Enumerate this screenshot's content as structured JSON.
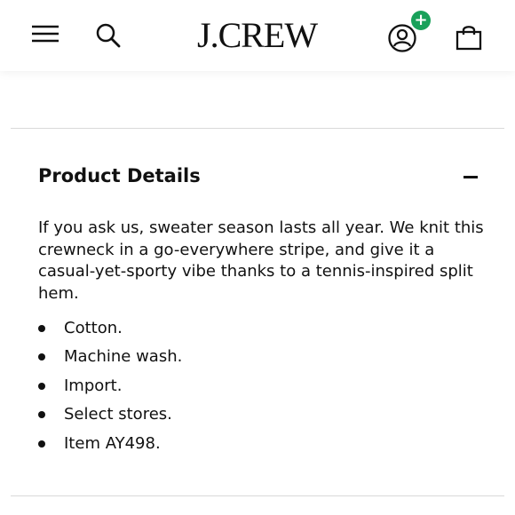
{
  "header": {
    "logo_text": "J.CREW",
    "icons": {
      "menu": "hamburger-menu-icon",
      "search": "search-icon",
      "account": "account-icon",
      "add_badge": "plus-icon",
      "bag": "shopping-bag-icon"
    },
    "badge_symbol": "+",
    "badge_color": "#19a15a"
  },
  "product_details": {
    "title": "Product Details",
    "collapse_icon": "minus-icon",
    "description": "If you ask us, sweater season lasts all year. We knit this crewneck in a go-everywhere stripe, and give it a casual-yet-sporty vibe thanks to a tennis-inspired split hem.",
    "bullets": [
      "Cotton.",
      "Machine wash.",
      "Import.",
      "Select stores.",
      "Item AY498."
    ]
  }
}
